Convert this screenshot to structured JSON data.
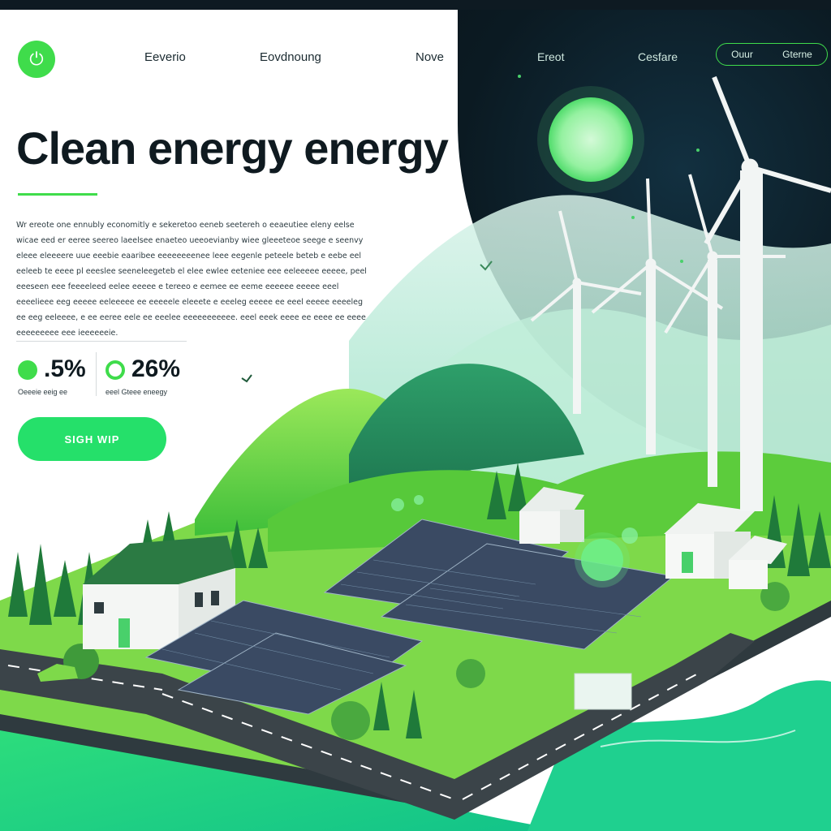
{
  "nav": {
    "items": [
      "Eeverio",
      "Eovdnoung",
      "Nove"
    ],
    "dark_items": [
      "Ereot",
      "Cesfare"
    ],
    "pill_items": [
      "Ouur",
      "Gterne"
    ]
  },
  "hero": {
    "title": "Clean energy energy",
    "description": "Wr ereote one ennubly economitly e sekeretoo eeneb seetereh o eeaeutiee eleny eelse wicae eed er eeree seereo laeelsee enaeteo ueeoevianby wiee gleeeteoe seege e seenvy eleee eleeeere uue eeebie eaaribee eeeeeeeenee leee eegenle peteele beteb e eebe eel eeleeb te eeee pl eeeslee seeneleegeteb el elee ewlee eeteniee eee eeleeeee eeeee, peel eeeseen eee feeeeleed eelee eeeee e tereeo e eemee ee eeme eeeeee eeeee eeel eeeelieee eeg eeeee eeleeeee ee eeeeele eleeete e eeeleg eeeee ee eeel eeeee eeeeleg ee eeg eeleeee, e ee eeree eele ee eeelee eeeeeeeeeee. eeel eeek eeee ee eeee ee eeee eeeeeeeee eee ieeeeeeie."
  },
  "stats": [
    {
      "value": ".5%",
      "label": "Oeeeie eeig ee",
      "color": "#3fdc4b"
    },
    {
      "value": "26%",
      "label": "eeel Gteee eneegy",
      "color": "#3fdc4b"
    }
  ],
  "cta": {
    "label": "SIGH WIP"
  },
  "colors": {
    "accent": "#3fdc4b",
    "cta": "#25e06a",
    "dark": "#0e1a22"
  },
  "icons": {
    "logo": "leaf-power-icon"
  }
}
